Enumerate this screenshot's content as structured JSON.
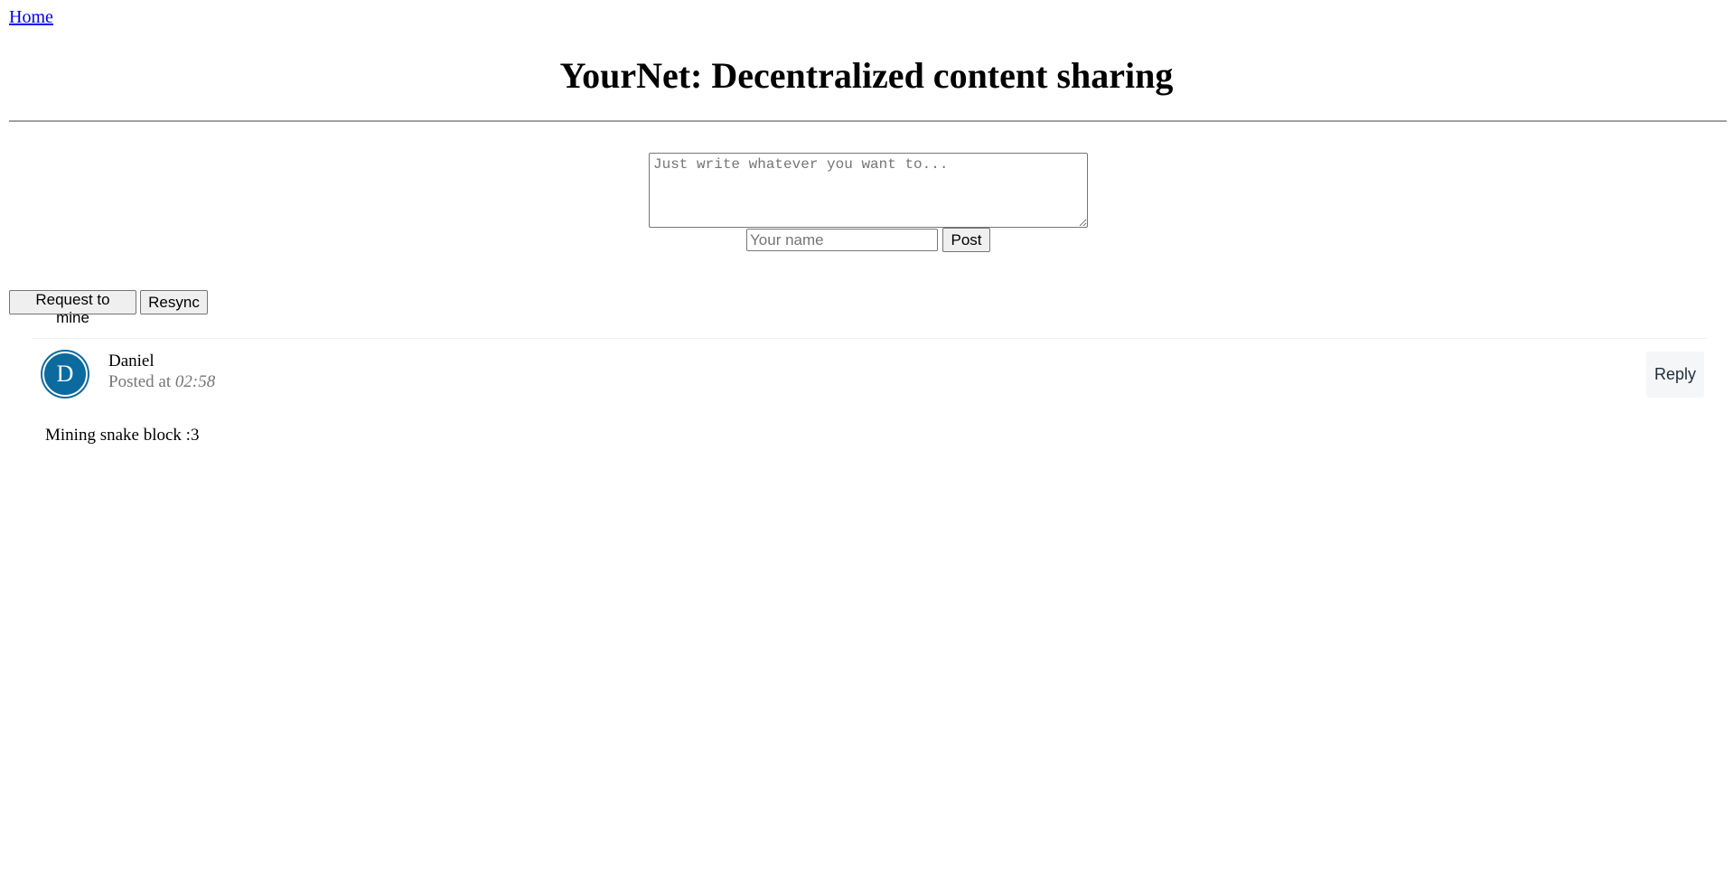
{
  "nav": {
    "home_label": "Home"
  },
  "header": {
    "title": "YourNet: Decentralized content sharing"
  },
  "composer": {
    "placeholder": "Just write whatever you want to...",
    "name_placeholder": "Your name",
    "post_label": "Post"
  },
  "actions": {
    "request_mine_label": "Request to mine",
    "resync_label": "Resync"
  },
  "posts": [
    {
      "avatar_letter": "D",
      "author": "Daniel",
      "posted_prefix": "Posted at",
      "time": "02:58",
      "reply_label": "Reply",
      "body": "Mining snake block :3"
    }
  ],
  "colors": {
    "avatar_bg": "#0b6a9e",
    "link": "#0000ee",
    "meta_text": "#757575"
  }
}
